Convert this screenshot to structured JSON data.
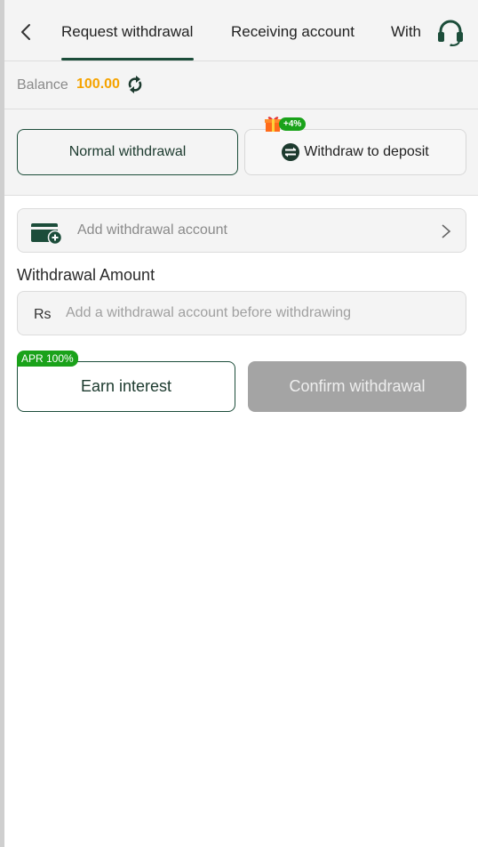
{
  "nav": {
    "tabs": [
      {
        "label": "Request withdrawal",
        "active": true
      },
      {
        "label": "Receiving account",
        "active": false
      },
      {
        "label": "With",
        "active": false
      }
    ],
    "back_icon": "chevron-left-icon",
    "support_icon": "headset-icon"
  },
  "balance": {
    "label": "Balance",
    "value": "100.00",
    "refresh_icon": "refresh-icon"
  },
  "methods": {
    "normal_label": "Normal withdrawal",
    "deposit_label": "Withdraw to deposit",
    "bonus_badge": "+4%"
  },
  "account": {
    "add_label": "Add withdrawal account",
    "card_icon": "card-add-icon"
  },
  "amount": {
    "label": "Withdrawal Amount",
    "currency": "Rs",
    "placeholder": "Add a withdrawal account before withdrawing"
  },
  "actions": {
    "apr_badge": "APR 100%",
    "earn_label": "Earn interest",
    "confirm_label": "Confirm withdrawal"
  },
  "colors": {
    "primary": "#1c4d3a",
    "accent": "#f5a300",
    "badge_green": "#1aa21a",
    "disabled": "#a4a4a4"
  }
}
